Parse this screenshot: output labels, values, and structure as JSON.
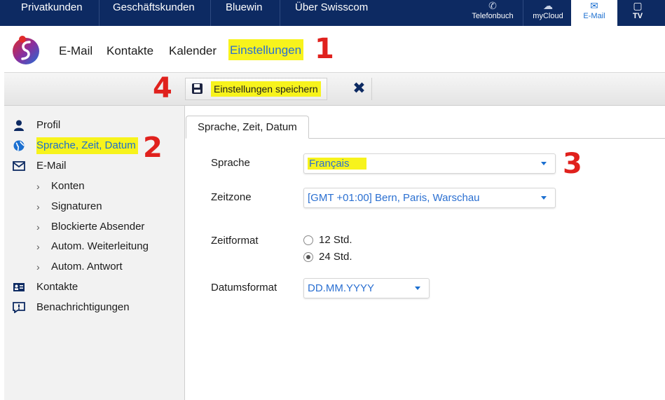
{
  "topnav": {
    "links": [
      "Privatkunden",
      "Geschäftskunden",
      "Bluewin",
      "Über Swisscom"
    ],
    "services": [
      {
        "label": "Telefonbuch",
        "icon": "phone-icon"
      },
      {
        "label": "myCloud",
        "icon": "cloud-icon"
      },
      {
        "label": "E-Mail",
        "icon": "mail-icon",
        "active": true
      },
      {
        "label": "TV",
        "icon": "tv-icon"
      }
    ]
  },
  "appnav": {
    "items": [
      "E-Mail",
      "Kontakte",
      "Kalender",
      "Einstellungen"
    ],
    "active": "Einstellungen"
  },
  "toolbar": {
    "save_label": "Einstellungen speichern",
    "close_icon": "close-icon"
  },
  "sidebar": {
    "items": [
      {
        "label": "Profil",
        "icon": "user-icon"
      },
      {
        "label": "Sprache, Zeit, Datum",
        "icon": "globe-icon",
        "selected": true
      },
      {
        "label": "E-Mail",
        "icon": "mail-icon"
      },
      {
        "label": "Konten",
        "sub": true
      },
      {
        "label": "Signaturen",
        "sub": true
      },
      {
        "label": "Blockierte Absender",
        "sub": true
      },
      {
        "label": "Autom. Weiterleitung",
        "sub": true
      },
      {
        "label": "Autom. Antwort",
        "sub": true
      },
      {
        "label": "Kontakte",
        "icon": "contact-card-icon"
      },
      {
        "label": "Benachrichtigungen",
        "icon": "notification-icon"
      }
    ]
  },
  "content": {
    "tab_label": "Sprache, Zeit, Datum",
    "language": {
      "label": "Sprache",
      "value": "Français"
    },
    "timezone": {
      "label": "Zeitzone",
      "value": "[GMT +01:00] Bern, Paris, Warschau"
    },
    "timeformat": {
      "label": "Zeitformat",
      "options": [
        "12 Std.",
        "24 Std."
      ],
      "selected": "24 Std."
    },
    "dateformat": {
      "label": "Datumsformat",
      "value": "DD.MM.YYYY"
    }
  },
  "annotations": [
    "1",
    "2",
    "3",
    "4"
  ],
  "colors": {
    "topnav_bg": "#0d2a62",
    "accent": "#1b6fd0",
    "highlight": "#f7f31c",
    "annotation": "#e0211d"
  }
}
